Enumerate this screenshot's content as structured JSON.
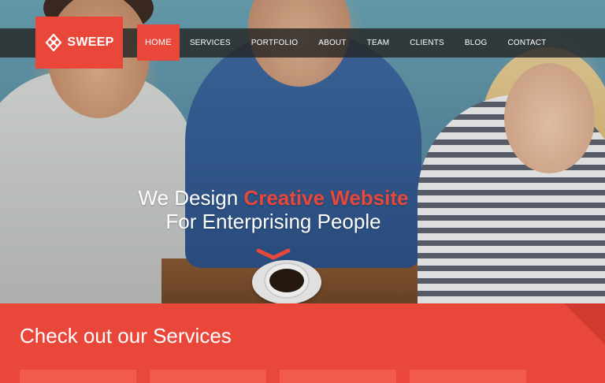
{
  "brand": {
    "name": "SWEEP",
    "color": "#e8473a"
  },
  "nav": {
    "items": [
      {
        "label": "HOME",
        "active": true
      },
      {
        "label": "SERVICES",
        "active": false
      },
      {
        "label": "PORTFOLIO",
        "active": false
      },
      {
        "label": "ABOUT",
        "active": false
      },
      {
        "label": "TEAM",
        "active": false
      },
      {
        "label": "CLIENTS",
        "active": false
      },
      {
        "label": "BLOG",
        "active": false
      },
      {
        "label": "CONTACT",
        "active": false
      }
    ]
  },
  "hero": {
    "line1_prefix": "We Design ",
    "line1_accent": "Creative Website",
    "line2": "For Enterprising People",
    "scroll_icon": "chevron-down-icon"
  },
  "services": {
    "title_prefix": "Check out our ",
    "title_strong": "Services",
    "cards": 4
  }
}
